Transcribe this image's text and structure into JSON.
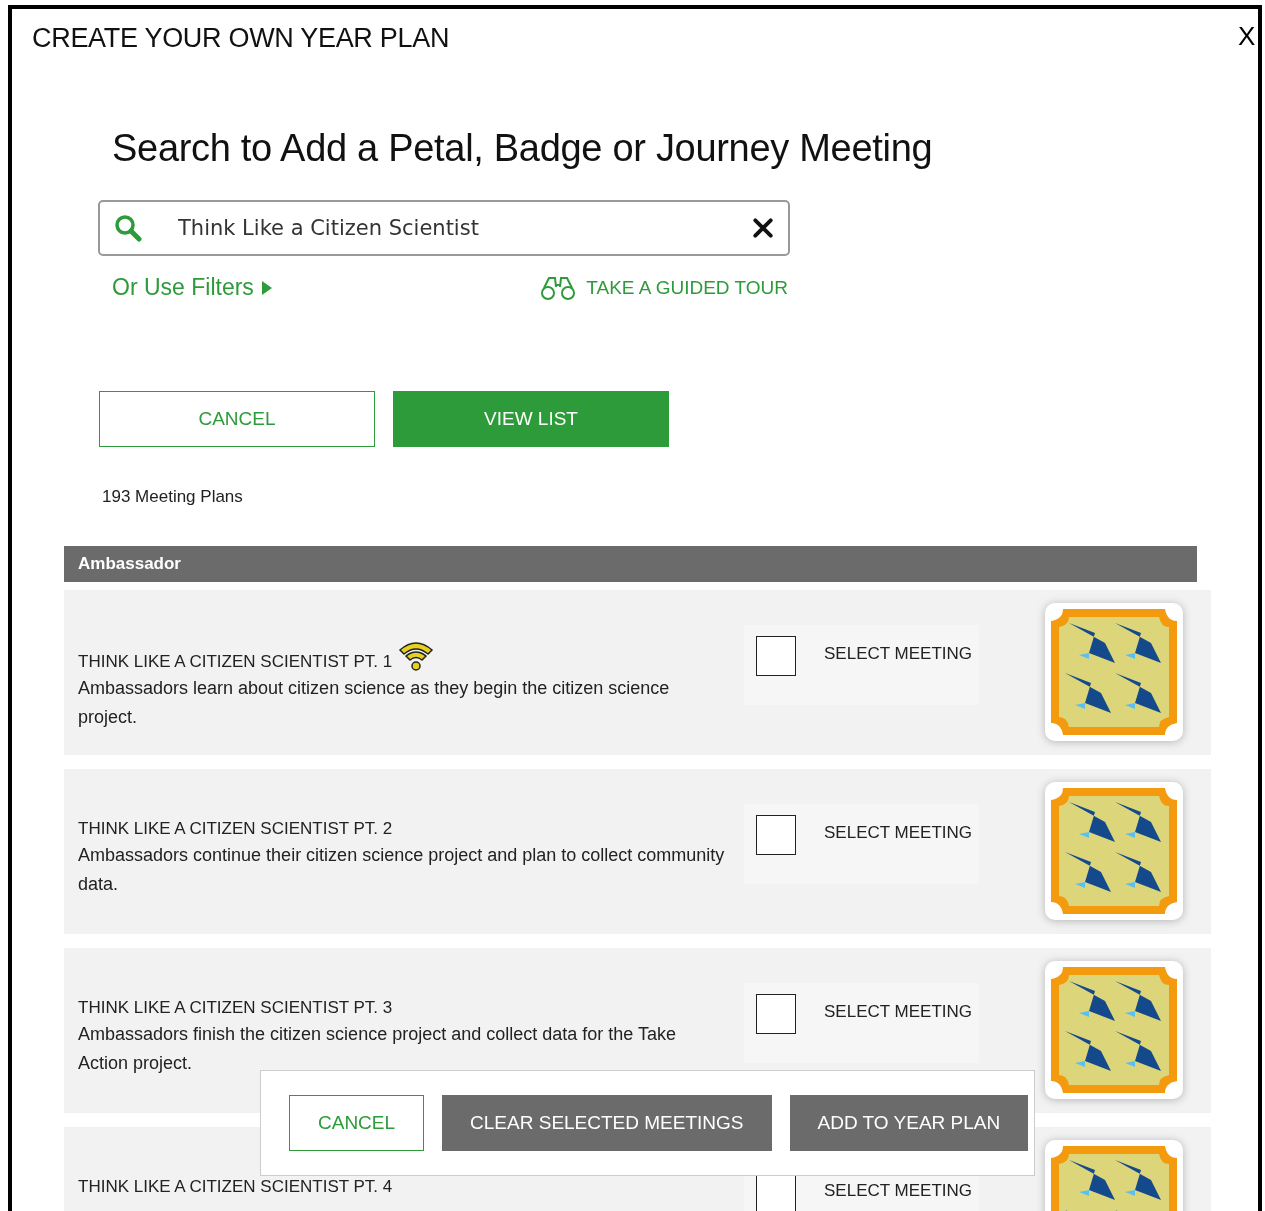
{
  "modal": {
    "title": "CREATE YOUR OWN YEAR PLAN",
    "close": "X"
  },
  "search": {
    "heading": "Search to Add a Petal, Badge or Journey Meeting",
    "value": "Think Like a Citizen Scientist",
    "filters_link": "Or Use Filters",
    "tour_link": "TAKE A GUIDED TOUR"
  },
  "buttons": [
    {
      "label": "CANCEL",
      "kind": "outline"
    },
    {
      "label": "VIEW LIST",
      "kind": "primary"
    }
  ],
  "count": "193 Meeting Plans",
  "section": {
    "title": "Ambassador"
  },
  "meetings": [
    {
      "title": "THINK LIKE A CITIZEN SCIENTIST PT. 1",
      "virtual": true,
      "description": "Ambassadors learn about citizen science as they begin the citizen science project.",
      "select_label": "SELECT MEETING",
      "checked": false
    },
    {
      "title": "THINK LIKE A CITIZEN SCIENTIST PT. 2",
      "virtual": false,
      "description": "Ambassadors continue their citizen science project and plan to collect community data.",
      "select_label": "SELECT MEETING",
      "checked": false
    },
    {
      "title": "THINK LIKE A CITIZEN SCIENTIST PT. 3",
      "virtual": false,
      "description": "Ambassadors finish the citizen science project and collect data for the Take Action project.",
      "select_label": "SELECT MEETING",
      "checked": false
    },
    {
      "title": "THINK LIKE A CITIZEN SCIENTIST PT. 4",
      "virtual": false,
      "select_label": "SELECT MEETING",
      "checked": false
    }
  ],
  "footer_buttons": [
    {
      "label": "CANCEL",
      "kind": "outline"
    },
    {
      "label": "CLEAR SELECTED MEETINGS",
      "kind": "dark"
    },
    {
      "label": "ADD TO YEAR PLAN",
      "kind": "dark"
    }
  ]
}
